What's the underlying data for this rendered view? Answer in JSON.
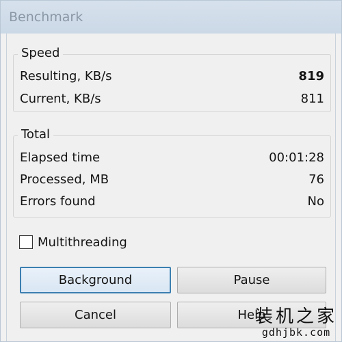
{
  "window": {
    "title": "Benchmark"
  },
  "speed": {
    "legend": "Speed",
    "resulting_label": "Resulting, KB/s",
    "resulting_value": "819",
    "current_label": "Current, KB/s",
    "current_value": "811"
  },
  "total": {
    "legend": "Total",
    "elapsed_label": "Elapsed time",
    "elapsed_value": "00:01:28",
    "processed_label": "Processed, MB",
    "processed_value": "76",
    "errors_label": "Errors found",
    "errors_value": "No"
  },
  "options": {
    "multithreading_label": "Multithreading",
    "multithreading_checked": false
  },
  "buttons": {
    "background": "Background",
    "pause": "Pause",
    "cancel": "Cancel",
    "help": "Help"
  },
  "watermark": {
    "text": "装机之家",
    "url": "gdhjbk.com"
  },
  "colors": {
    "focus_border": "#3c7fb1",
    "titlebar": "#cbd8e6"
  }
}
